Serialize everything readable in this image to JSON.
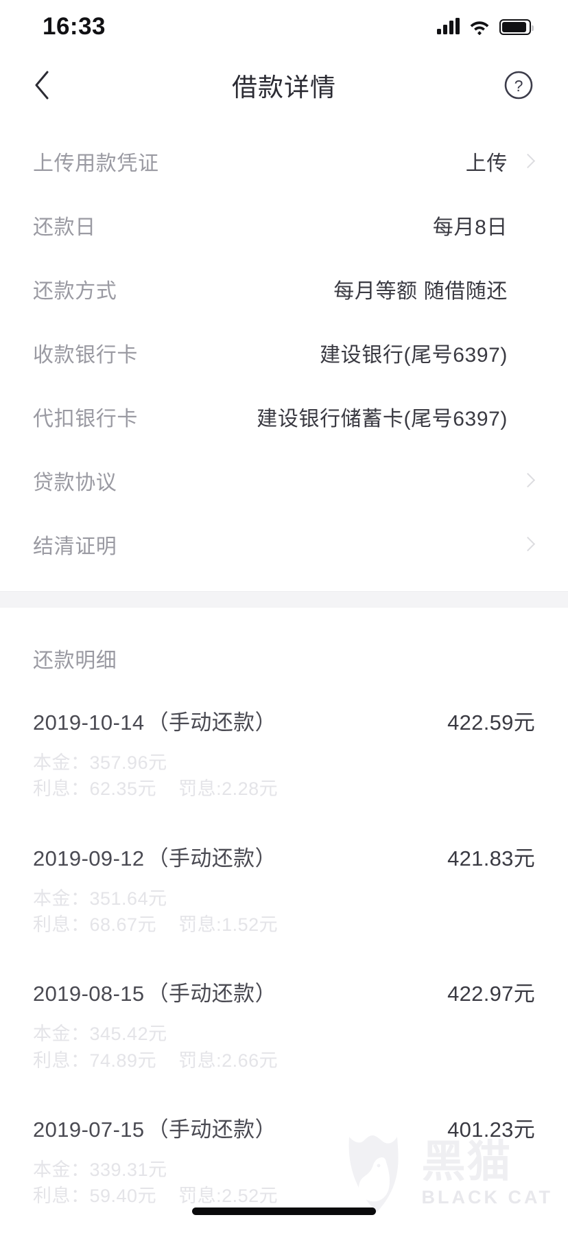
{
  "status_bar": {
    "time": "16:33",
    "icons": [
      "signal-icon",
      "wifi-icon",
      "battery-icon"
    ]
  },
  "nav": {
    "back_icon": "chevron-left-icon",
    "title": "借款详情",
    "help_icon": "question-circle-icon"
  },
  "details": [
    {
      "label": "上传用款凭证",
      "value": "上传",
      "chevron": true
    },
    {
      "label": "还款日",
      "value": "每月8日",
      "chevron": false
    },
    {
      "label": "还款方式",
      "value": "每月等额 随借随还",
      "chevron": false
    },
    {
      "label": "收款银行卡",
      "value": "建设银行(尾号6397)",
      "chevron": false
    },
    {
      "label": "代扣银行卡",
      "value": "建设银行储蓄卡(尾号6397)",
      "chevron": false
    },
    {
      "label": "贷款协议",
      "value": "",
      "chevron": true
    },
    {
      "label": "结清证明",
      "value": "",
      "chevron": true
    }
  ],
  "repayment": {
    "heading": "还款明细",
    "items": [
      {
        "date": "2019-10-14",
        "type": "（手动还款）",
        "amount": "422.59元",
        "principal": "本金：357.96元",
        "interest": "利息：62.35元",
        "penalty": "罚息:2.28元"
      },
      {
        "date": "2019-09-12",
        "type": "（手动还款）",
        "amount": "421.83元",
        "principal": "本金：351.64元",
        "interest": "利息：68.67元",
        "penalty": "罚息:1.52元"
      },
      {
        "date": "2019-08-15",
        "type": "（手动还款）",
        "amount": "422.97元",
        "principal": "本金：345.42元",
        "interest": "利息：74.89元",
        "penalty": "罚息:2.66元"
      },
      {
        "date": "2019-07-15",
        "type": "（手动还款）",
        "amount": "401.23元",
        "principal": "本金：339.31元",
        "interest": "利息：59.40元",
        "penalty": "罚息:2.52元"
      }
    ]
  },
  "watermark": {
    "cn": "黑猫",
    "en": "BLACK CAT"
  },
  "colors": {
    "label": "#9a9aa2",
    "value": "#3a3a42",
    "faded": "#e4e4e8",
    "divider": "#f4f4f6"
  }
}
